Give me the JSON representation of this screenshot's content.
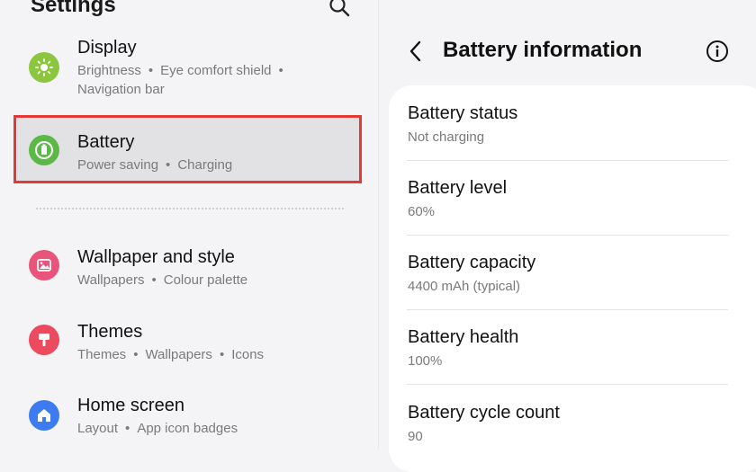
{
  "left_panel": {
    "title": "Settings",
    "items": [
      {
        "title": "Display",
        "sub1": "Brightness",
        "sub2": "Eye comfort shield",
        "sub3": "Navigation bar",
        "icon": "sun-icon",
        "color": "#8cc63f"
      },
      {
        "title": "Battery",
        "sub1": "Power saving",
        "sub2": "Charging",
        "icon": "battery-icon",
        "color": "#5cb947"
      },
      {
        "title": "Wallpaper and style",
        "sub1": "Wallpapers",
        "sub2": "Colour palette",
        "icon": "image-icon",
        "color": "#e9547a"
      },
      {
        "title": "Themes",
        "sub1": "Themes",
        "sub2": "Wallpapers",
        "sub3": "Icons",
        "icon": "brush-icon",
        "color": "#ec4a5e"
      },
      {
        "title": "Home screen",
        "sub1": "Layout",
        "sub2": "App icon badges",
        "icon": "home-icon",
        "color": "#3d7cf0"
      }
    ],
    "separator": "•"
  },
  "right_panel": {
    "title": "Battery information",
    "rows": [
      {
        "label": "Battery status",
        "value": "Not charging"
      },
      {
        "label": "Battery level",
        "value": "60%"
      },
      {
        "label": "Battery capacity",
        "value": "4400 mAh (typical)"
      },
      {
        "label": "Battery health",
        "value": "100%"
      },
      {
        "label": "Battery cycle count",
        "value": "90"
      }
    ]
  },
  "colors": {
    "highlight_border": "#e53935",
    "background": "#f4f4f6",
    "card": "#ffffff"
  }
}
